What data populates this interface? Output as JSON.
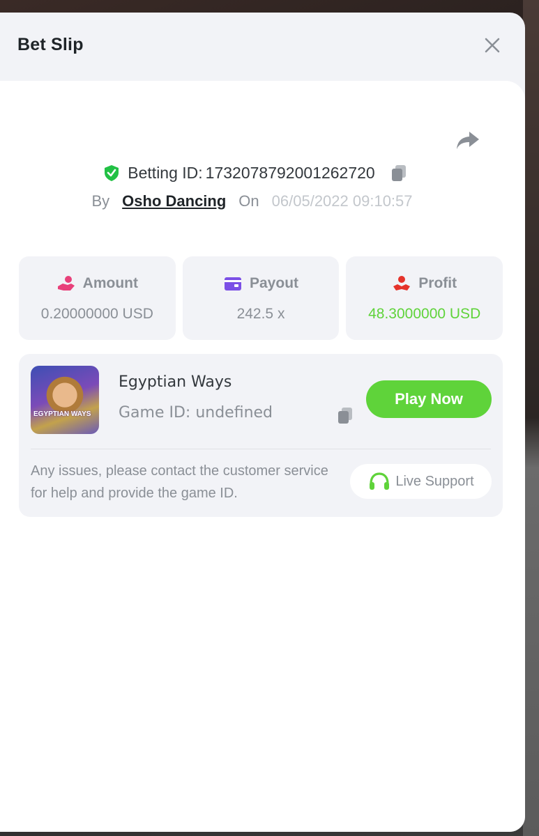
{
  "modal": {
    "title": "Bet Slip"
  },
  "bet": {
    "betting_id_label": "Betting ID:",
    "betting_id": "1732078792001262720",
    "by_label": "By",
    "username": "Osho Dancing",
    "on_label": "On",
    "datetime": "06/05/2022 09:10:57"
  },
  "stats": {
    "amount": {
      "label": "Amount",
      "value": "0.20000000 USD",
      "icon": "money-hand-icon",
      "color": "#e8407a"
    },
    "payout": {
      "label": "Payout",
      "value": "242.5 x",
      "icon": "wallet-icon",
      "color": "#7b4fe6"
    },
    "profit": {
      "label": "Profit",
      "value": "48.3000000 USD",
      "icon": "profit-icon",
      "color": "#e5332b"
    }
  },
  "game": {
    "thumbnail_text": "EGYPTIAN WAYS",
    "name": "Egyptian Ways",
    "id_label": "Game ID: undefined",
    "play_label": "Play Now",
    "help_text": "Any issues, please contact the customer service for help and provide the game ID.",
    "support_label": "Live Support"
  },
  "colors": {
    "accent_green": "#5fd33a",
    "shield_green": "#22c145"
  }
}
